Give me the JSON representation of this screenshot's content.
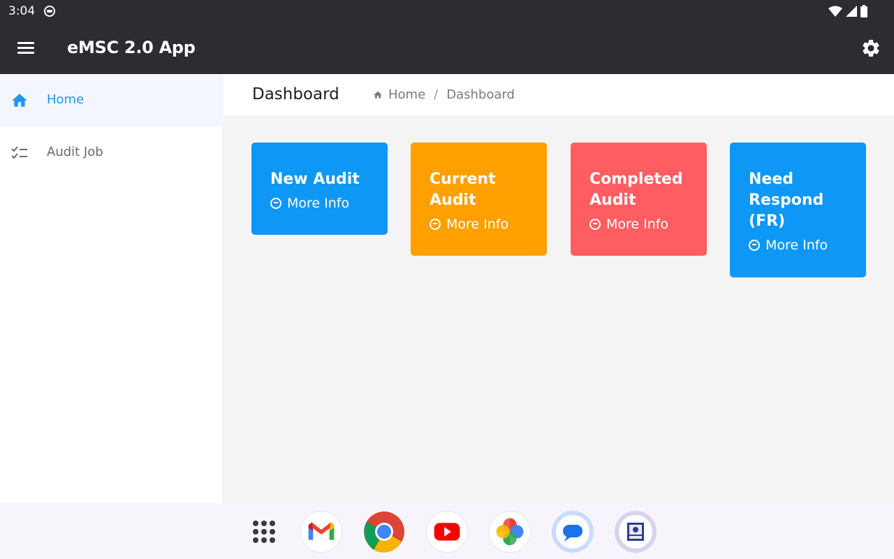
{
  "status": {
    "time": "3:04"
  },
  "appbar": {
    "title": "eMSC 2.0 App"
  },
  "sidebar": {
    "items": [
      {
        "label": "Home",
        "icon": "home-icon",
        "active": true
      },
      {
        "label": "Audit Job",
        "icon": "checklist-icon",
        "active": false
      }
    ]
  },
  "page": {
    "title": "Dashboard",
    "breadcrumb": {
      "home": "Home",
      "sep": "/",
      "current": "Dashboard"
    }
  },
  "cards": [
    {
      "title": "New Audit",
      "more": "More Info",
      "color": "#0e97f5"
    },
    {
      "title": "Current Audit",
      "more": "More Info",
      "color": "#ff9f00"
    },
    {
      "title": "Completed Audit",
      "more": "More Info",
      "color": "#fe5e62"
    },
    {
      "title": "Need Respond (FR)",
      "more": "More Info",
      "color": "#0e97f5"
    }
  ],
  "dock": {
    "apps": [
      "app-drawer-icon",
      "gmail-icon",
      "chrome-icon",
      "youtube-icon",
      "google-photos-icon",
      "messages-icon",
      "emsc-app-icon"
    ]
  }
}
